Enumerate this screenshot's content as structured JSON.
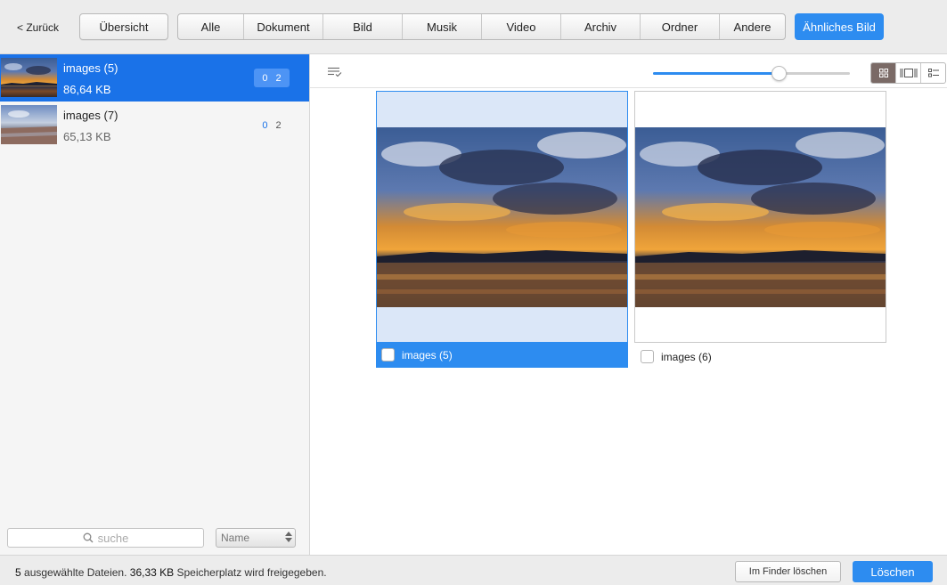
{
  "toolbar": {
    "back_label": "< Zurück",
    "overview_label": "Übersicht",
    "filters": [
      "Alle",
      "Dokument",
      "Bild",
      "Musik",
      "Video",
      "Archiv",
      "Ordner",
      "Andere"
    ],
    "similar_label": "Ähnliches Bild"
  },
  "sidebar": {
    "files": [
      {
        "name": "images (5)",
        "size": "86,64 KB",
        "count_a": "0",
        "count_b": "2",
        "selected": true
      },
      {
        "name": "images (7)",
        "size": "65,13 KB",
        "count_a": "0",
        "count_b": "2",
        "selected": false
      }
    ],
    "search_placeholder": "suche",
    "sort_value": "Name"
  },
  "viewer": {
    "zoom_fraction": 0.64,
    "view_modes": [
      "grid-view-icon",
      "filmstrip-view-icon",
      "list-view-icon"
    ],
    "active_view": "grid-view-icon",
    "items": [
      {
        "label": "images (5)",
        "selected": true
      },
      {
        "label": "images (6)",
        "selected": false
      }
    ]
  },
  "status": {
    "count": "5",
    "count_text": " ausgewählte Dateien. ",
    "freed_size": "36,33 KB",
    "freed_text": " Speicherplatz wird freigegeben.",
    "finder_label": "Im Finder löschen",
    "delete_label": "Löschen"
  },
  "colors": {
    "accent": "#2d8cf0",
    "selected_row": "#1a72e8",
    "toolbar_bg": "#ececec"
  }
}
